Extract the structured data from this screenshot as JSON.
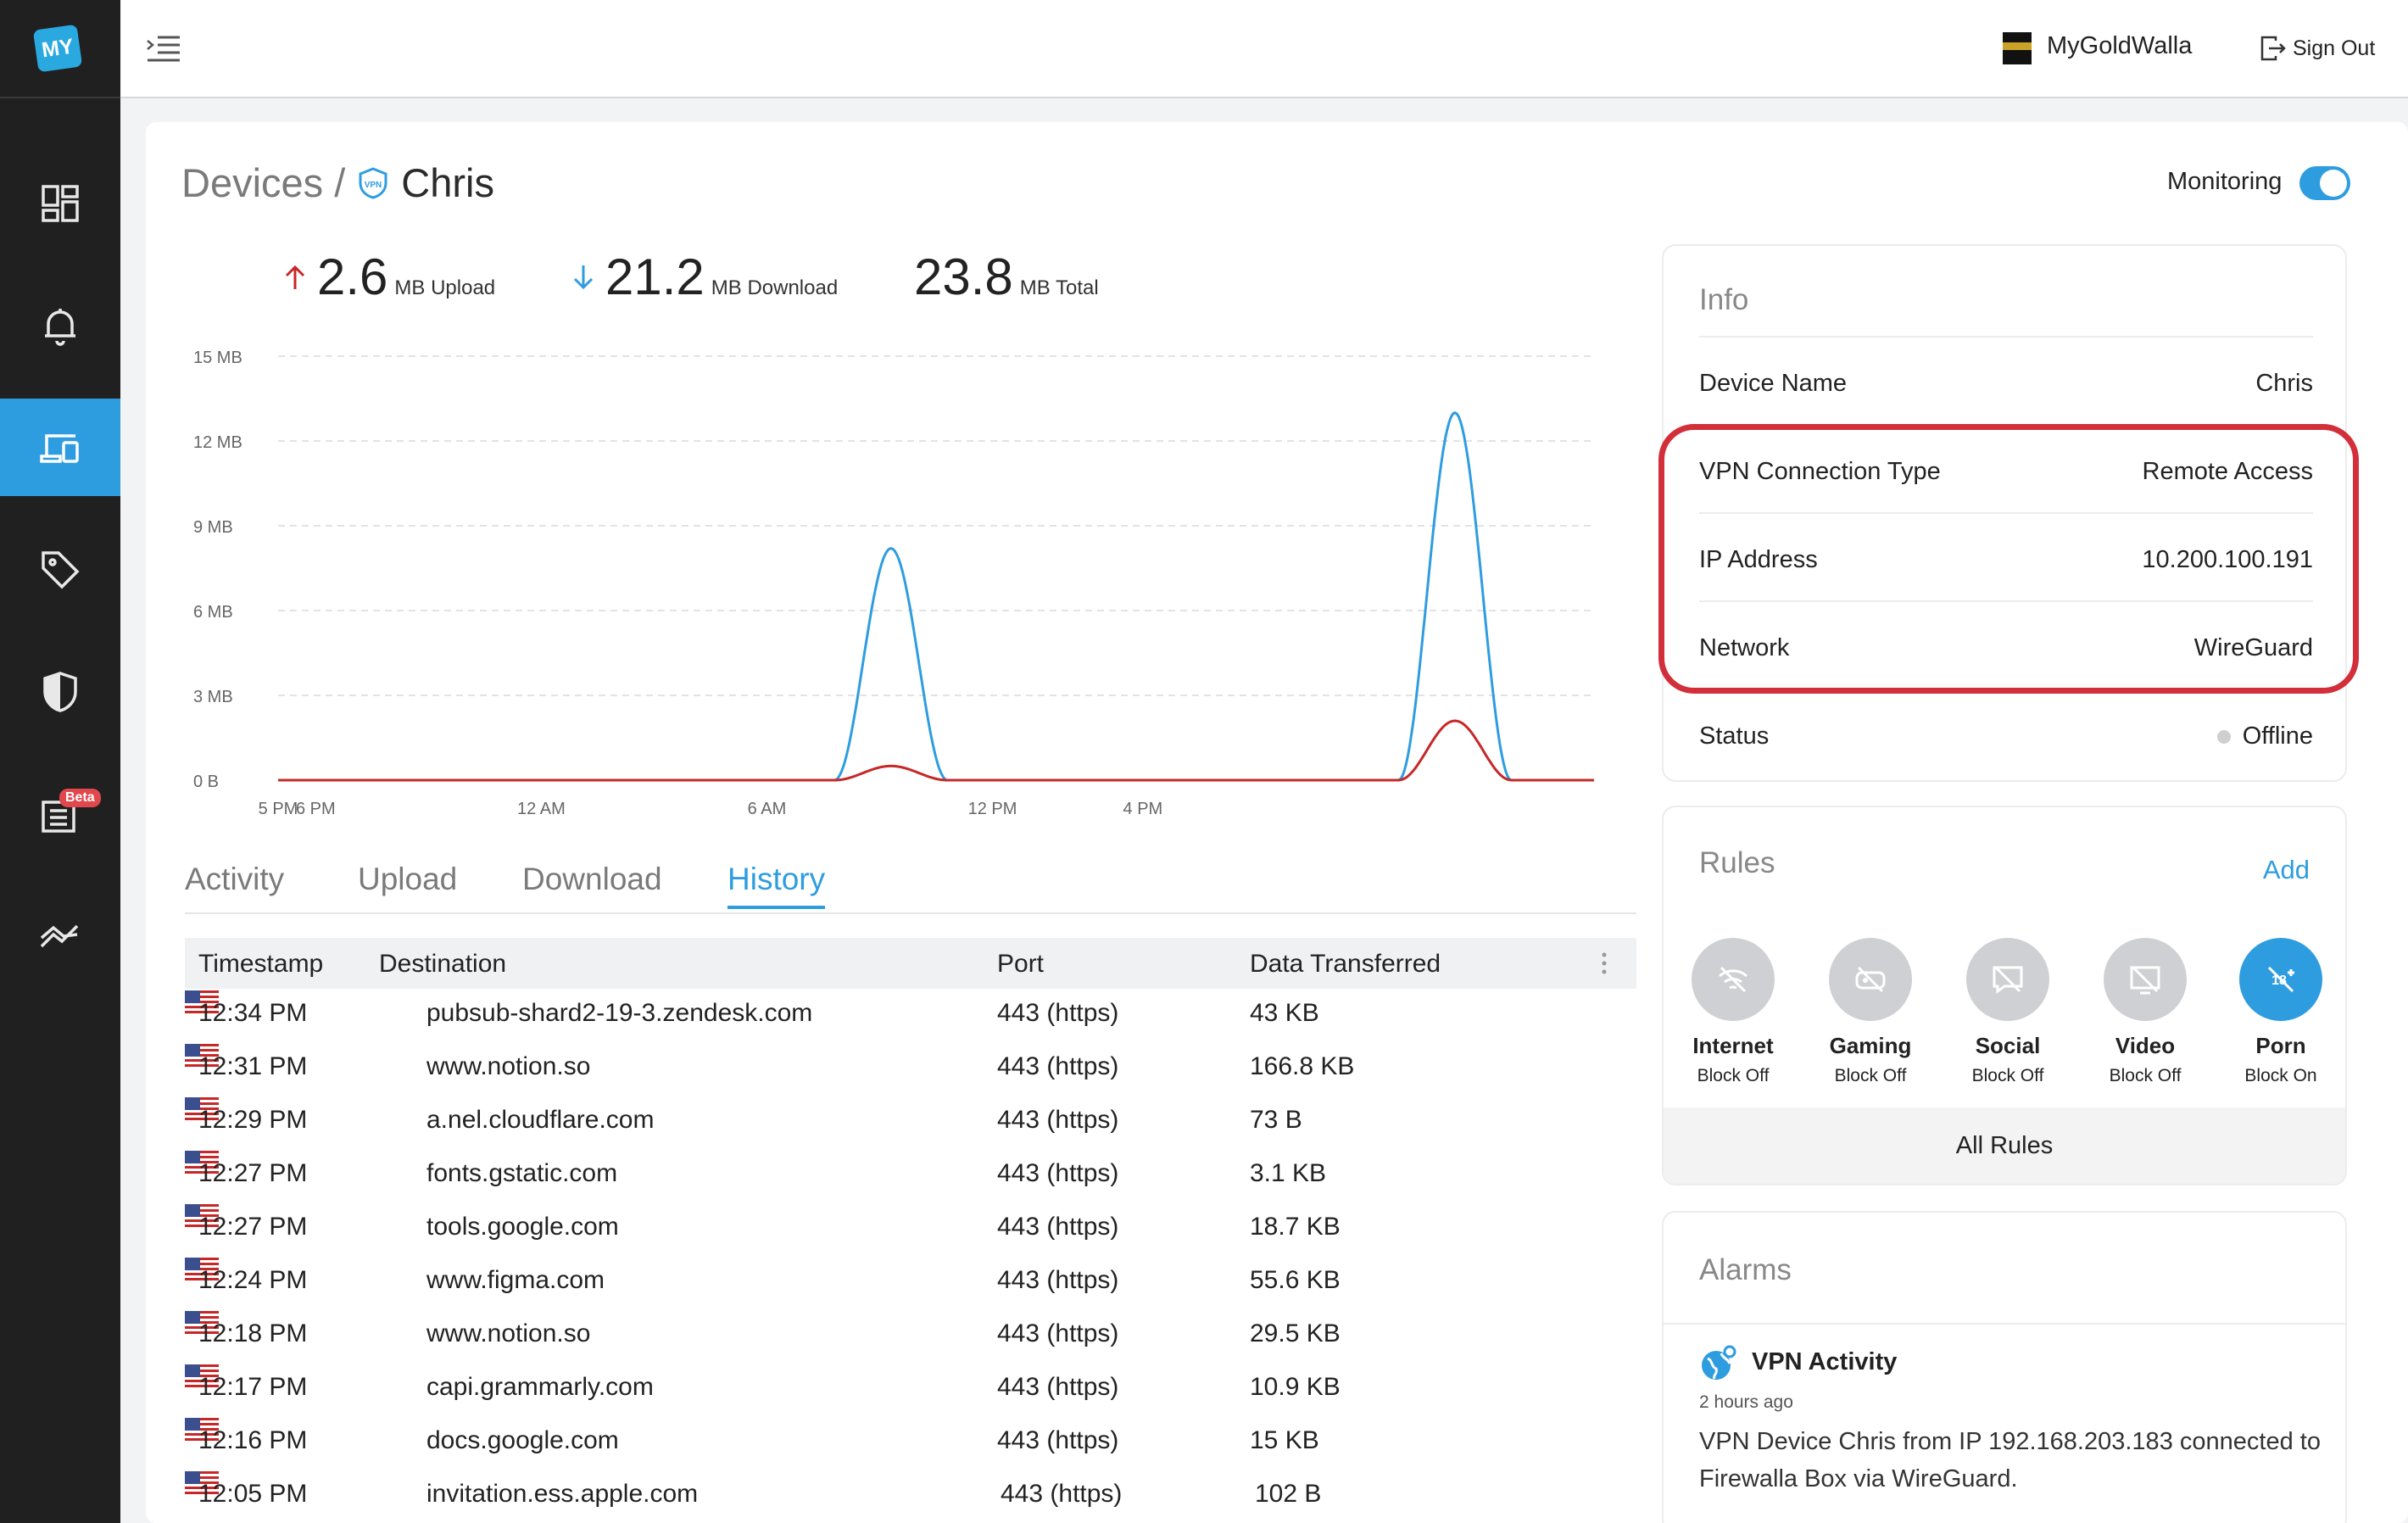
{
  "logo": {
    "text": "MY"
  },
  "sidebar": {
    "beta_badge": "Beta"
  },
  "header": {
    "brand_name": "MyGoldWalla",
    "sign_out": "Sign Out"
  },
  "page": {
    "breadcrumb_root": "Devices /",
    "device_name": "Chris",
    "monitoring_label": "Monitoring",
    "monitoring_on": true
  },
  "stats": {
    "upload": {
      "value": "2.6",
      "unit": "MB Upload"
    },
    "download": {
      "value": "21.2",
      "unit": "MB Download"
    },
    "total": {
      "value": "23.8",
      "unit": "MB Total"
    }
  },
  "chart_data": {
    "type": "line",
    "title": "",
    "xlabel": "",
    "ylabel": "",
    "y_ticks": [
      "0 B",
      "3 MB",
      "6 MB",
      "9 MB",
      "12 MB",
      "15 MB"
    ],
    "ylim": [
      0,
      15
    ],
    "x_tick_labels": [
      "5 PM",
      "6 PM",
      "12 AM",
      "6 AM",
      "12 PM",
      "4 PM"
    ],
    "x": [
      17,
      24,
      36,
      40,
      41,
      42,
      43,
      44,
      48,
      49,
      50,
      51,
      52,
      53
    ],
    "series": [
      {
        "values": [
          0,
          0,
          0,
          0,
          0,
          8.2,
          0,
          0,
          0,
          0,
          0,
          13,
          0,
          0
        ],
        "color": "#2e9de0"
      },
      {
        "values": [
          0,
          0,
          0,
          0,
          0,
          0.5,
          0,
          0,
          0,
          0,
          0,
          2.1,
          0,
          0
        ],
        "color": "#c62828"
      }
    ],
    "grid": true
  },
  "tabs": [
    {
      "label": "Activity",
      "active": false
    },
    {
      "label": "Upload",
      "active": false
    },
    {
      "label": "Download",
      "active": false
    },
    {
      "label": "History",
      "active": true
    }
  ],
  "table": {
    "columns": [
      "Timestamp",
      "Destination",
      "Port",
      "Data Transferred"
    ],
    "rows": [
      {
        "time": "12:34 PM",
        "dest": "pubsub-shard2-19-3.zendesk.com",
        "port": "443 (https)",
        "data": "43 KB"
      },
      {
        "time": "12:31 PM",
        "dest": "www.notion.so",
        "port": "443 (https)",
        "data": "166.8 KB"
      },
      {
        "time": "12:29 PM",
        "dest": "a.nel.cloudflare.com",
        "port": "443 (https)",
        "data": "73 B"
      },
      {
        "time": "12:27 PM",
        "dest": "fonts.gstatic.com",
        "port": "443 (https)",
        "data": "3.1 KB"
      },
      {
        "time": "12:27 PM",
        "dest": "tools.google.com",
        "port": "443 (https)",
        "data": "18.7 KB"
      },
      {
        "time": "12:24 PM",
        "dest": "www.figma.com",
        "port": "443 (https)",
        "data": "55.6 KB"
      },
      {
        "time": "12:18 PM",
        "dest": "www.notion.so",
        "port": "443 (https)",
        "data": "29.5 KB"
      },
      {
        "time": "12:17 PM",
        "dest": "capi.grammarly.com",
        "port": "443 (https)",
        "data": "10.9 KB"
      },
      {
        "time": "12:16 PM",
        "dest": "docs.google.com",
        "port": "443 (https)",
        "data": "15 KB"
      },
      {
        "time": "12:05 PM",
        "dest": "invitation.ess.apple.com",
        "port": "443 (https)",
        "data": "102 B"
      }
    ]
  },
  "info": {
    "title": "Info",
    "rows": [
      {
        "key": "Device Name",
        "value": "Chris"
      },
      {
        "key": "VPN Connection Type",
        "value": "Remote Access"
      },
      {
        "key": "IP Address",
        "value": "10.200.100.191"
      },
      {
        "key": "Network",
        "value": "WireGuard"
      },
      {
        "key": "Status",
        "value": "Offline"
      }
    ]
  },
  "rules": {
    "title": "Rules",
    "add_label": "Add",
    "items": [
      {
        "name": "Internet",
        "state": "Block Off",
        "icon": "wifi-off-icon",
        "on": false
      },
      {
        "name": "Gaming",
        "state": "Block Off",
        "icon": "gamepad-off-icon",
        "on": false
      },
      {
        "name": "Social",
        "state": "Block Off",
        "icon": "chat-off-icon",
        "on": false
      },
      {
        "name": "Video",
        "state": "Block Off",
        "icon": "video-off-icon",
        "on": false
      },
      {
        "name": "Porn",
        "state": "Block On",
        "icon": "adult-block-icon",
        "on": true
      }
    ],
    "all_rules_label": "All Rules"
  },
  "alarms": {
    "title": "Alarms",
    "item": {
      "title": "VPN Activity",
      "time": "2 hours ago",
      "text": "VPN Device Chris from IP 192.168.203.183 connected to Firewalla Box via WireGuard."
    }
  },
  "colors": {
    "accent": "#2e9de0",
    "upload": "#c62828",
    "highlight": "#d32f3a",
    "sidebar": "#202020"
  }
}
